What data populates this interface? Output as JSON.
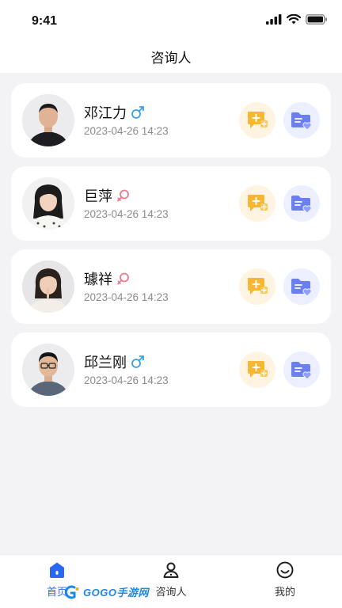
{
  "status_bar": {
    "time": "9:41"
  },
  "nav": {
    "title": "咨询人"
  },
  "consultants": [
    {
      "name": "邓江力",
      "gender": "male",
      "time": "2023-04-26 14:23"
    },
    {
      "name": "巨萍",
      "gender": "female",
      "time": "2023-04-26 14:23"
    },
    {
      "name": "璩祥",
      "gender": "female",
      "time": "2023-04-26 14:23"
    },
    {
      "name": "邱兰刚",
      "gender": "male",
      "time": "2023-04-26 14:23"
    }
  ],
  "tabs": [
    {
      "label": "首页",
      "icon": "home-icon",
      "active": true
    },
    {
      "label": "咨询人",
      "icon": "person-icon",
      "active": false
    },
    {
      "label": "我的",
      "icon": "smile-icon",
      "active": false
    }
  ],
  "watermark": {
    "text": "GOGO手游网"
  },
  "colors": {
    "accent": "#2a68f0",
    "male": "#3aa0e8",
    "female": "#f07a8a",
    "chat_bg": "#fff4e2",
    "folder_bg": "#ecefff"
  }
}
